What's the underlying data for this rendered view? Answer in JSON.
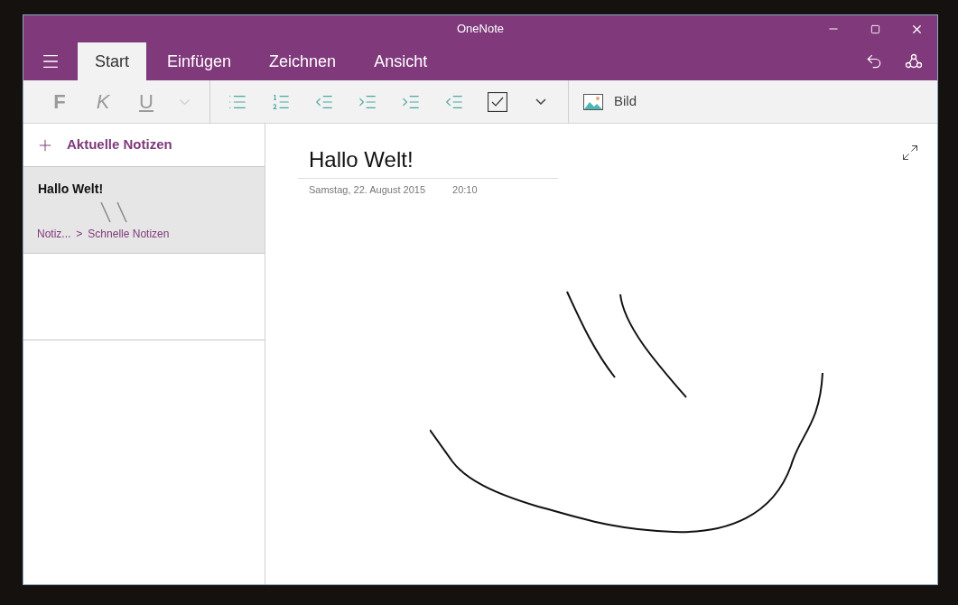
{
  "window": {
    "title": "OneNote"
  },
  "tabs": [
    {
      "label": "Start",
      "selected": true
    },
    {
      "label": "Einfügen",
      "selected": false
    },
    {
      "label": "Zeichnen",
      "selected": false
    },
    {
      "label": "Ansicht",
      "selected": false
    }
  ],
  "format_buttons": [
    {
      "label": "F",
      "kind": "bold",
      "disabled": true
    },
    {
      "label": "K",
      "kind": "italic",
      "disabled": true
    },
    {
      "label": "U",
      "kind": "underline",
      "disabled": true
    }
  ],
  "insert_button": {
    "label": "Bild"
  },
  "sidebar": {
    "add_label": "Aktuelle Notizen",
    "pages": [
      {
        "title": "Hallo Welt!",
        "notebook": "Notiz...",
        "separator": ">",
        "section": "Schnelle Notizen",
        "selected": true
      }
    ]
  },
  "page": {
    "title": "Hallo Welt!",
    "date": "Samstag, 22. August 2015",
    "time": "20:10"
  }
}
